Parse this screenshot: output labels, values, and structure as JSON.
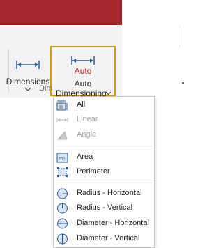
{
  "ribbon": {
    "dimensions_label": "Dimensions",
    "auto_label_red": "Auto",
    "auto_label_line1": "Auto",
    "auto_label_line2": "Dimensioning",
    "group_label": "Dim"
  },
  "menu": {
    "items": [
      {
        "label": "All",
        "icon": "dimension-all-icon",
        "enabled": true
      },
      {
        "label": "Linear",
        "icon": "linear-dimension-icon",
        "enabled": false
      },
      {
        "label": "Angle",
        "icon": "angle-dimension-icon",
        "enabled": false
      },
      {
        "label": "Area",
        "icon": "area-icon",
        "enabled": true
      },
      {
        "label": "Perimeter",
        "icon": "perimeter-icon",
        "enabled": true
      },
      {
        "label": "Radius - Horizontal",
        "icon": "radius-horizontal-icon",
        "enabled": true
      },
      {
        "label": "Radius - Vertical",
        "icon": "radius-vertical-icon",
        "enabled": true
      },
      {
        "label": "Diameter - Horizontal",
        "icon": "diameter-horizontal-icon",
        "enabled": true
      },
      {
        "label": "Diameter - Vertical",
        "icon": "diameter-vertical-icon",
        "enabled": true
      }
    ]
  },
  "colors": {
    "title_bar": "#a4262c",
    "auto_text": "#c8272a",
    "highlight_border": "#c79a2b",
    "icon_blue": "#2b5797"
  }
}
